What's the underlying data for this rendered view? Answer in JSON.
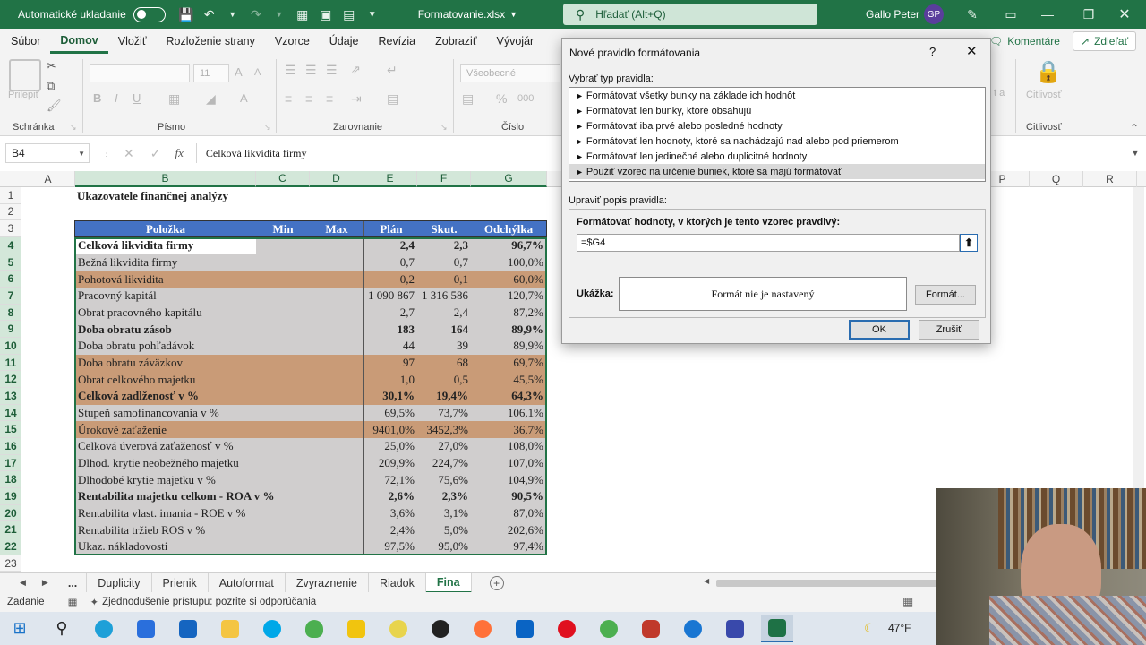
{
  "titlebar": {
    "autosave_label": "Automatické ukladanie",
    "filename": "Formatovanie.xlsx",
    "search_placeholder": "Hľadať (Alt+Q)",
    "user_name": "Gallo Peter",
    "user_initials": "GP"
  },
  "ribbon": {
    "tabs": [
      "Súbor",
      "Domov",
      "Vložiť",
      "Rozloženie strany",
      "Vzorce",
      "Údaje",
      "Revízia",
      "Zobraziť",
      "Vývojár"
    ],
    "comments_label": "Komentáre",
    "share_label": "Zdieľať",
    "font_size": "11",
    "number_format": "Všeobecné",
    "paste_label": "Prilepiť",
    "groups": {
      "clipboard": "Schránka",
      "font": "Písmo",
      "alignment": "Zarovnanie",
      "number": "Číslo",
      "sensitivity": "Citlivosť"
    },
    "sensitivity_label": "Citlivosť",
    "partial_label": "t a"
  },
  "formula_bar": {
    "name_box": "B4",
    "fx": "fx",
    "content": "Celková likvidita firmy"
  },
  "columns": [
    "A",
    "B",
    "C",
    "D",
    "E",
    "F",
    "G",
    "P",
    "Q",
    "R"
  ],
  "rows": [
    "1",
    "2",
    "3",
    "4",
    "5",
    "6",
    "7",
    "8",
    "9",
    "10",
    "11",
    "12",
    "13",
    "14",
    "15",
    "16",
    "17",
    "18",
    "19",
    "20",
    "21",
    "22",
    "23"
  ],
  "sheet": {
    "title": "Ukazovatele finančnej analýzy",
    "headers": {
      "item": "Položka",
      "min": "Min",
      "max": "Max",
      "plan": "Plán",
      "actual": "Skut.",
      "diff": "Odchýlka"
    },
    "data": [
      {
        "item": "Celková likvidita firmy",
        "plan": "2,4",
        "actual": "2,3",
        "diff": "96,7%",
        "bold": true,
        "bg": "#d0cece"
      },
      {
        "item": "Bežná likvidita firmy",
        "plan": "0,7",
        "actual": "0,7",
        "diff": "100,0%",
        "bold": false,
        "bg": "#d0cece"
      },
      {
        "item": "Pohotová likvidita",
        "plan": "0,2",
        "actual": "0,1",
        "diff": "60,0%",
        "bold": false,
        "bg": "#c99b77"
      },
      {
        "item": "Pracovný kapitál",
        "plan": "1 090 867",
        "actual": "1 316 586",
        "diff": "120,7%",
        "bold": false,
        "bg": "#d0cece"
      },
      {
        "item": "Obrat pracovného kapitálu",
        "plan": "2,7",
        "actual": "2,4",
        "diff": "87,2%",
        "bold": false,
        "bg": "#d0cece"
      },
      {
        "item": "Doba obratu zásob",
        "plan": "183",
        "actual": "164",
        "diff": "89,9%",
        "bold": true,
        "bg": "#d0cece"
      },
      {
        "item": "Doba obratu pohľadávok",
        "plan": "44",
        "actual": "39",
        "diff": "89,9%",
        "bold": false,
        "bg": "#d0cece"
      },
      {
        "item": "Doba obratu záväzkov",
        "plan": "97",
        "actual": "68",
        "diff": "69,7%",
        "bold": false,
        "bg": "#c99b77"
      },
      {
        "item": "Obrat celkového majetku",
        "plan": "1,0",
        "actual": "0,5",
        "diff": "45,5%",
        "bold": false,
        "bg": "#c99b77"
      },
      {
        "item": "Celková zadlženosť v %",
        "plan": "30,1%",
        "actual": "19,4%",
        "diff": "64,3%",
        "bold": true,
        "bg": "#c99b77"
      },
      {
        "item": "Stupeň samofinancovania v %",
        "plan": "69,5%",
        "actual": "73,7%",
        "diff": "106,1%",
        "bold": false,
        "bg": "#d0cece"
      },
      {
        "item": "Úrokové zaťaženie",
        "plan": "9401,0%",
        "actual": "3452,3%",
        "diff": "36,7%",
        "bold": false,
        "bg": "#c99b77"
      },
      {
        "item": "Celková úverová zaťaženosť v %",
        "plan": "25,0%",
        "actual": "27,0%",
        "diff": "108,0%",
        "bold": false,
        "bg": "#d0cece"
      },
      {
        "item": "Dlhod. krytie neobežného majetku",
        "plan": "209,9%",
        "actual": "224,7%",
        "diff": "107,0%",
        "bold": false,
        "bg": "#d0cece"
      },
      {
        "item": "Dlhodobé krytie majetku v %",
        "plan": "72,1%",
        "actual": "75,6%",
        "diff": "104,9%",
        "bold": false,
        "bg": "#d0cece"
      },
      {
        "item": "Rentabilita majetku celkom - ROA v %",
        "plan": "2,6%",
        "actual": "2,3%",
        "diff": "90,5%",
        "bold": true,
        "bg": "#d0cece"
      },
      {
        "item": "Rentabilita vlast. imania - ROE v %",
        "plan": "3,6%",
        "actual": "3,1%",
        "diff": "87,0%",
        "bold": false,
        "bg": "#d0cece"
      },
      {
        "item": "Rentabilita tržieb ROS v %",
        "plan": "2,4%",
        "actual": "5,0%",
        "diff": "202,6%",
        "bold": false,
        "bg": "#d0cece"
      },
      {
        "item": "Ukaz. nákladovosti",
        "plan": "97,5%",
        "actual": "95,0%",
        "diff": "97,4%",
        "bold": false,
        "bg": "#d0cece"
      }
    ]
  },
  "sheet_tabs": [
    "Duplicity",
    "Prienik",
    "Autoformat",
    "Zvyraznenie",
    "Riadok",
    "Fina"
  ],
  "active_sheet": "Fina",
  "status": {
    "mode": "Zadanie",
    "accessibility": "Zjednodušenie prístupu: pozrite si odporúčania"
  },
  "dialog": {
    "title": "Nové pravidlo formátovania",
    "help": "?",
    "select_type_label": "Vybrať typ pravidla:",
    "rule_types": [
      "Formátovať všetky bunky na základe ich hodnôt",
      "Formátovať len bunky, ktoré obsahujú",
      "Formátovať iba prvé alebo posledné hodnoty",
      "Formátovať len hodnoty, ktoré sa nachádzajú nad alebo pod priemerom",
      "Formátovať len jedinečné alebo duplicitné hodnoty",
      "Použiť vzorec na určenie buniek, ktoré sa majú formátovať"
    ],
    "selected_rule_index": 5,
    "edit_label": "Upraviť popis pravidla:",
    "formula_label": "Formátovať hodnoty, v ktorých je tento vzorec pravdivý:",
    "formula_value": "=$G4",
    "preview_label": "Ukážka:",
    "preview_text": "Formát nie je nastavený",
    "format_button": "Formát...",
    "ok_button": "OK",
    "cancel_button": "Zrušiť"
  },
  "taskbar": {
    "temperature": "47°F"
  },
  "colors": {
    "excel_green": "#217346",
    "header_blue": "#4472c4",
    "row_gray": "#d0cece",
    "row_brown": "#c99b77"
  }
}
